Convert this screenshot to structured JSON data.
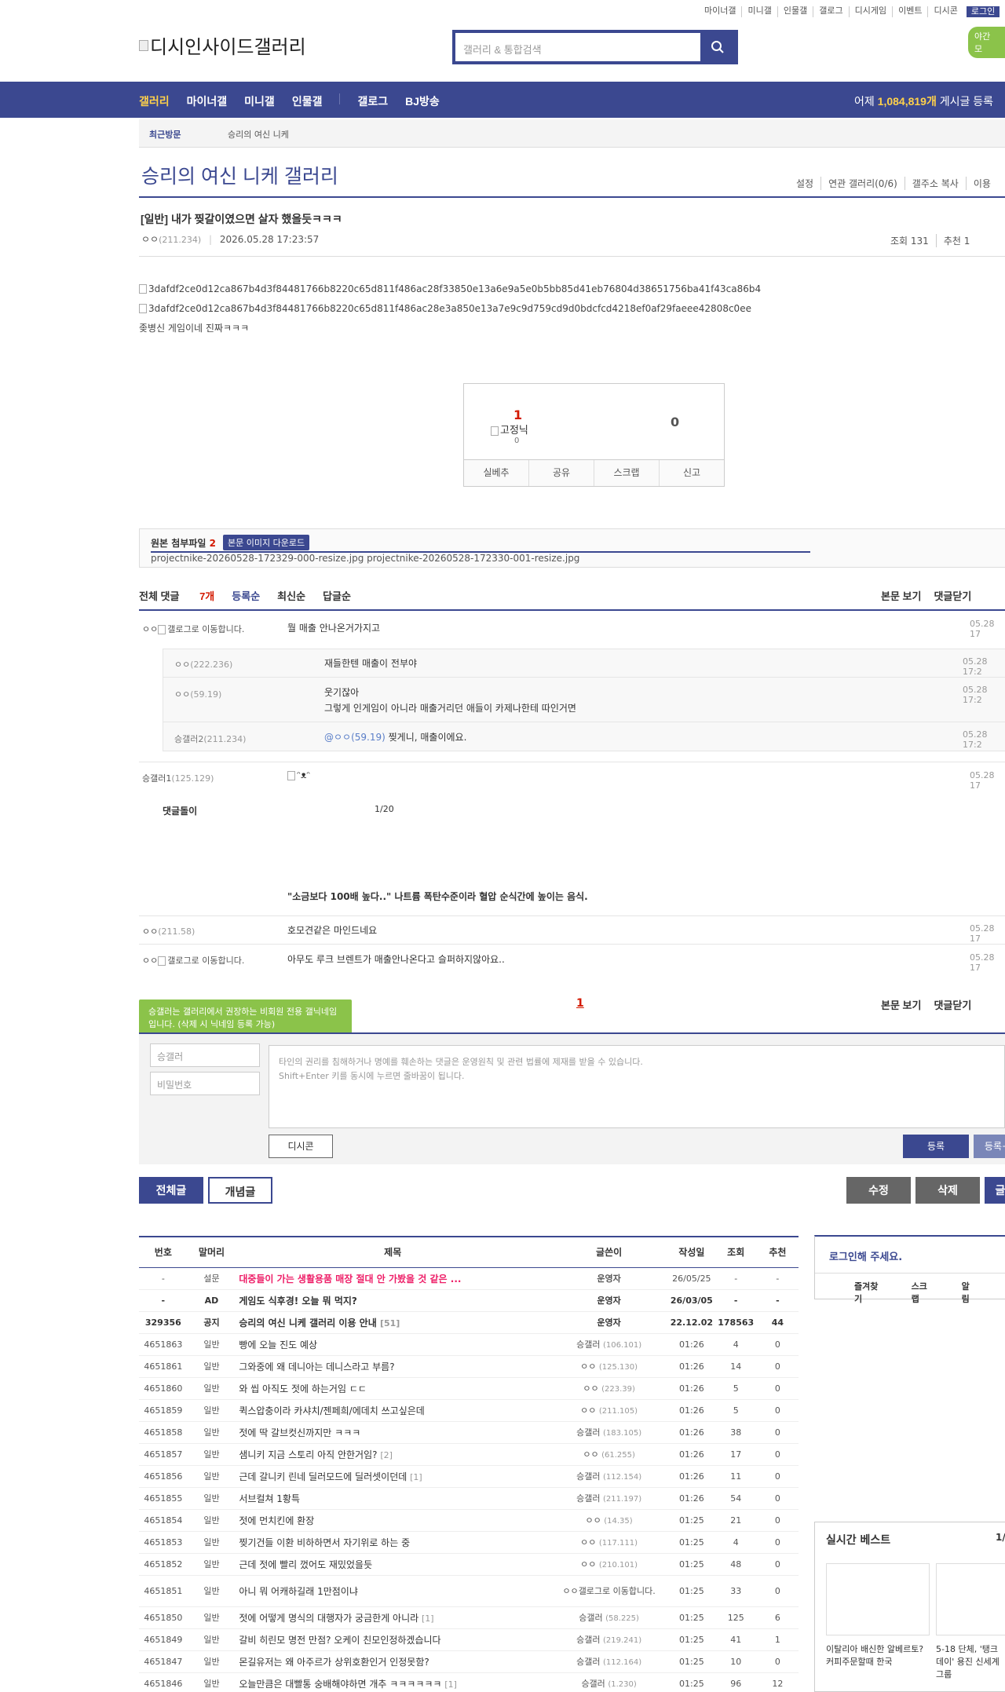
{
  "util": [
    "마이너갤",
    "미니갤",
    "인물갤",
    "갤로그",
    "디시게임",
    "이벤트",
    "디시콘",
    "로그인"
  ],
  "logo": "디시인사이드갤러리",
  "search_placeholder": "갤러리 & 통합검색",
  "night_label": "야간 모",
  "gnb": {
    "items": [
      "갤러리",
      "마이너갤",
      "미니갤",
      "인물갤",
      "갤로그",
      "BJ방송"
    ],
    "count_prefix": "어제 ",
    "count_value": "1,084,819개",
    "count_suffix": " 게시글 등록"
  },
  "recent": {
    "label": "최근방문",
    "value": "승리의 여신 니케"
  },
  "gallery_title": "승리의 여신 니케 갤러리",
  "gallery_tools": [
    "설정",
    "연관 갤러리(0/6)",
    "갤주소 복사",
    "이용"
  ],
  "post": {
    "title": "[일반] 내가 찢갈이였으면 살자 했을듯ㅋㅋㅋ",
    "writer": "ㅇㅇ",
    "ip": "(211.234)",
    "date": "2026.05.28 17:23:57",
    "views": "조회 131",
    "recommend": "추천 1",
    "images": [
      "3dafdf2ce0d12ca867b4d3f84481766b8220c65d811f486ac28f33850e13a6e9a5e0b5bb85d41eb76804d38651756ba41f43ca86b4",
      "3dafdf2ce0d12ca867b4d3f84481766b8220c65d811f486ac28e3a850e13a7e9c9d759cd9d0bdcfcd4218ef0af29faeee42808c0ee"
    ],
    "text": "좆병신 게임이네 진짜ㅋㅋㅋ"
  },
  "recbox": {
    "up": "1",
    "fixed": "고정닉",
    "fixed_count": "0",
    "down": "0",
    "buttons": [
      "실베추",
      "공유",
      "스크랩",
      "신고"
    ]
  },
  "files": {
    "label": "원본 첨부파일",
    "count": "2",
    "download": "본문 이미지 다운로드",
    "list": "projectnike-20260528-172329-000-resize.jpg  projectnike-20260528-172330-001-resize.jpg"
  },
  "comments_head": {
    "total_label": "전체 댓글",
    "total_count": "7개",
    "sort": [
      "등록순",
      "최신순",
      "답글순"
    ],
    "right": [
      "본문 보기",
      "댓글닫기"
    ]
  },
  "comments": [
    {
      "nick": "ㅇㅇ",
      "gallog": "갤로그로 이동합니다.",
      "text": "뭘 매출 안나온거가지고",
      "date": "05.28 17"
    },
    {
      "nick": "ㅇㅇ",
      "ip": "(222.236)",
      "text": "재들한텐 매출이 전부야",
      "date": "05.28 17:2"
    },
    {
      "nick": "ㅇㅇ",
      "ip": "(59.19)",
      "text": "웃기잖아",
      "text2": "그렇게 인게임이 아니라 매출거리던 애들이 카제나한테 따인거면",
      "date": "05.28 17:2"
    },
    {
      "nick": "승갤러2",
      "ip": "(211.234)",
      "at": "@ㅇㅇ(59.19)",
      "text": " 찢게니, 매출이에요.",
      "date": "05.28 17:2"
    },
    {
      "nick": "승갤러1",
      "ip": "(125.129)",
      "img": "ᵔᴥᵔ",
      "date": "05.28 17"
    },
    {
      "label": "댓글돌이",
      "page": "1/20"
    },
    {
      "ad": "\"소금보다 100배 높다..\" 나트륨 폭탄수준이라 혈압 순식간에 높이는 음식."
    },
    {
      "nick": "ㅇㅇ",
      "ip": "(211.58)",
      "text": "호모견같은 마인드네요",
      "date": "05.28 17"
    },
    {
      "nick": "ㅇㅇ",
      "gallog": "갤로그로 이동합니다.",
      "text": "아무도 루크 브렌트가 매출안나온다고 슬퍼하지않아요..",
      "date": "05.28 17"
    }
  ],
  "write": {
    "tip": "승갤러는 갤러리에서 권장하는 비회원 전용 갤닉네임입니다. (삭제 시 닉네임 등록 가능)",
    "page": "1",
    "right": [
      "본문 보기",
      "댓글닫기"
    ],
    "nick": "승갤러",
    "pw": "비밀번호",
    "placeholder1": "타인의 권리를 침해하거나 명예를 훼손하는 댓글은 운영원칙 및 관련 법률에 제재를 받을 수 있습니다.",
    "placeholder2": "Shift+Enter 키를 동시에 누르면 줄바꿈이 됩니다.",
    "dccon": "디시콘",
    "submit": "등록",
    "submit2": "등록+"
  },
  "buttons": {
    "all": "전체글",
    "concept": "개념글",
    "edit": "수정",
    "delete": "삭제",
    "write": "글"
  },
  "list": {
    "headers": [
      "번호",
      "말머리",
      "제목",
      "글쓴이",
      "작성일",
      "조회",
      "추천"
    ],
    "rows": [
      {
        "no": "-",
        "head": "설문",
        "title": "대중들이 가는 생활용품 매장 절대 안 가봤을 것 같은 ...",
        "rc": "",
        "writer": "운영자",
        "ip": "",
        "date": "26/05/25",
        "views": "-",
        "rec": "-",
        "type": "pink"
      },
      {
        "no": "-",
        "head": "AD",
        "title": "게임도 식후경! 오늘 뭐 먹지?",
        "rc": "",
        "writer": "운영자",
        "ip": "",
        "date": "26/03/05",
        "views": "-",
        "rec": "-",
        "type": "notice"
      },
      {
        "no": "329356",
        "head": "공지",
        "title": "승리의 여신 니케 갤러리 이용 안내",
        "rc": "[51]",
        "writer": "운영자",
        "ip": "",
        "date": "22.12.02",
        "views": "178563",
        "rec": "44",
        "type": "notice"
      },
      {
        "no": "4651863",
        "head": "일반",
        "title": "빵에 오늘 진도 예상",
        "rc": "",
        "writer": "승갤러",
        "ip": "(106.101)",
        "date": "01:26",
        "views": "4",
        "rec": "0"
      },
      {
        "no": "4651861",
        "head": "일반",
        "title": "그와중에 왜 데니아는 데니스라고 부름?",
        "rc": "",
        "writer": "ㅇㅇ",
        "ip": "(125.130)",
        "date": "01:26",
        "views": "14",
        "rec": "0"
      },
      {
        "no": "4651860",
        "head": "일반",
        "title": "와 씹 아직도 젓에 하는거임 ㄷㄷ",
        "rc": "",
        "writer": "ㅇㅇ",
        "ip": "(223.39)",
        "date": "01:26",
        "views": "5",
        "rec": "0"
      },
      {
        "no": "4651859",
        "head": "일반",
        "title": "퀵스압충이라 카샤치/젠페희/에데치 쓰고싶은데",
        "rc": "",
        "writer": "ㅇㅇ",
        "ip": "(211.105)",
        "date": "01:26",
        "views": "5",
        "rec": "0"
      },
      {
        "no": "4651858",
        "head": "일반",
        "title": "젓에 딱 갈브컷신까지만 ㅋㅋㅋ",
        "rc": "",
        "writer": "승갤러",
        "ip": "(183.105)",
        "date": "01:26",
        "views": "38",
        "rec": "0"
      },
      {
        "no": "4651857",
        "head": "일반",
        "title": "샘니키 지금 스토리 아직 안한거임?",
        "rc": "[2]",
        "writer": "ㅇㅇ",
        "ip": "(61.255)",
        "date": "01:26",
        "views": "17",
        "rec": "0"
      },
      {
        "no": "4651856",
        "head": "일반",
        "title": "근데 갈니키 린네 딜러모드에 딜러셋이던데",
        "rc": "[1]",
        "writer": "승갤러",
        "ip": "(112.154)",
        "date": "01:26",
        "views": "11",
        "rec": "0"
      },
      {
        "no": "4651855",
        "head": "일반",
        "title": "서브컬쳐 1황특",
        "rc": "",
        "writer": "승갤러",
        "ip": "(211.197)",
        "date": "01:26",
        "views": "54",
        "rec": "0"
      },
      {
        "no": "4651854",
        "head": "일반",
        "title": "젓에 먼치킨에 환장",
        "rc": "",
        "writer": "ㅇㅇ",
        "ip": "(14.35)",
        "date": "01:25",
        "views": "21",
        "rec": "0"
      },
      {
        "no": "4651853",
        "head": "일반",
        "title": "찢기건들 이환 비하하면서 자기위로 하는 중",
        "rc": "",
        "writer": "ㅇㅇ",
        "ip": "(117.111)",
        "date": "01:25",
        "views": "4",
        "rec": "0"
      },
      {
        "no": "4651852",
        "head": "일반",
        "title": "근데 젓에 빨리 껐어도 재밌었을듯",
        "rc": "",
        "writer": "ㅇㅇ",
        "ip": "(210.101)",
        "date": "01:25",
        "views": "48",
        "rec": "0"
      },
      {
        "no": "4651851",
        "head": "일반",
        "title": "아니 뭐 어캐하길래 1만점이냐",
        "rc": "",
        "writer": "ㅇㅇ",
        "ip": "",
        "gallog": "갤로그로 이동합니다.",
        "date": "01:25",
        "views": "33",
        "rec": "0",
        "tall": true
      },
      {
        "no": "4651850",
        "head": "일반",
        "title": "젓에 어떻게 명식의 대행자가 궁금한게 아니라",
        "rc": "[1]",
        "writer": "승갤러",
        "ip": "(58.225)",
        "date": "01:25",
        "views": "125",
        "rec": "6"
      },
      {
        "no": "4651849",
        "head": "일반",
        "title": "갈비 히린모 명전 만점? 오케이 친모인정하겠습니다",
        "rc": "",
        "writer": "승갤러",
        "ip": "(219.241)",
        "date": "01:25",
        "views": "41",
        "rec": "1"
      },
      {
        "no": "4651847",
        "head": "일반",
        "title": "몬길유저는 왜 아주르가 상위호환인거 인정못함?",
        "rc": "",
        "writer": "승갤러",
        "ip": "(112.164)",
        "date": "01:25",
        "views": "10",
        "rec": "0"
      },
      {
        "no": "4651846",
        "head": "일반",
        "title": "오늘만큼은 대빨통 숭배해야하면 개추 ㅋㅋㅋㅋㅋㅋ",
        "rc": "[1]",
        "writer": "승갤러",
        "ip": "(1.230)",
        "date": "01:25",
        "views": "96",
        "rec": "12"
      }
    ]
  },
  "side": {
    "login": "로그인해 주세요.",
    "links": [
      "즐겨찾기",
      "스크랩",
      "알림"
    ],
    "best": "실시간 베스트",
    "best_page": "1/",
    "cards": [
      "이탈리아 배신한 알베르토? 커피주문할때 한국",
      "5-18 단체, '탱크데이' 용진 신세계그룹"
    ]
  }
}
